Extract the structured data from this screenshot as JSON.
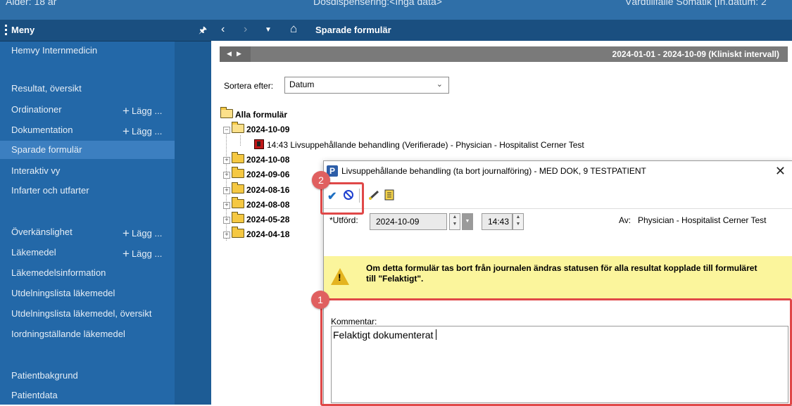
{
  "topbar": {
    "left": "Ålder: 18 år",
    "center": "Dosdispensering:<Inga data>",
    "right": "Vårdtillfälle Somatik [In.datum: 2"
  },
  "sidebar": {
    "title": "Meny",
    "pin_icon": "pin-icon",
    "add_label": "Lägg ...",
    "items": [
      {
        "label": "Hemvy Internmedicin"
      },
      {
        "label": "Resultat, översikt"
      },
      {
        "label": "Ordinationer",
        "add": true
      },
      {
        "label": "Dokumentation",
        "add": true
      },
      {
        "label": "Sparade formulär",
        "active": true
      },
      {
        "label": "Interaktiv vy"
      },
      {
        "label": "Infarter och utfarter"
      },
      {
        "label": "Överkänslighet",
        "add": true
      },
      {
        "label": "Läkemedel",
        "add": true
      },
      {
        "label": "Läkemedelsinformation"
      },
      {
        "label": "Utdelningslista läkemedel"
      },
      {
        "label": "Utdelningslista läkemedel, översikt"
      },
      {
        "label": "Iordningställande läkemedel"
      },
      {
        "label": "Patientbakgrund"
      },
      {
        "label": "Patientdata"
      }
    ]
  },
  "navbar": {
    "title": "Sparade formulär",
    "icons": [
      "back-icon",
      "forward-icon",
      "dropdown-icon",
      "home-icon"
    ]
  },
  "datebar": {
    "range": "2024-01-01 - 2024-10-09  (Kliniskt intervall)"
  },
  "sort": {
    "label": "Sortera efter:",
    "value": "Datum"
  },
  "tree": {
    "root": "Alla formulär",
    "expanded_date": "2024-10-09",
    "document": "14:43  Livsuppehållande behandling (Verifierade) - Physician - Hospitalist Cerner Test",
    "dates": [
      "2024-10-08",
      "2024-09-06",
      "2024-08-16",
      "2024-08-08",
      "2024-05-28",
      "2024-04-18"
    ]
  },
  "dialog": {
    "title": "Livsuppehållande behandling (ta bort journalföring) - MED DOK, 9 TESTPATIENT",
    "performed_label": "*Utförd:",
    "date": "2024-10-09",
    "time": "14:43",
    "by_label": "Av:",
    "by_value": "Physician - Hospitalist Cerner Test",
    "warning": "Om detta formulär tas bort från journalen ändras statusen för alla resultat kopplade till formuläret till \"Felaktigt\".",
    "comment_label": "Kommentar:",
    "comment_value": "Felaktigt dokumenterat"
  },
  "callouts": [
    "1",
    "2"
  ],
  "colors": {
    "sidebar": "#2368a8",
    "header": "#1a4f80",
    "highlight": "#e04848",
    "warning_bg": "#fbf59c"
  }
}
